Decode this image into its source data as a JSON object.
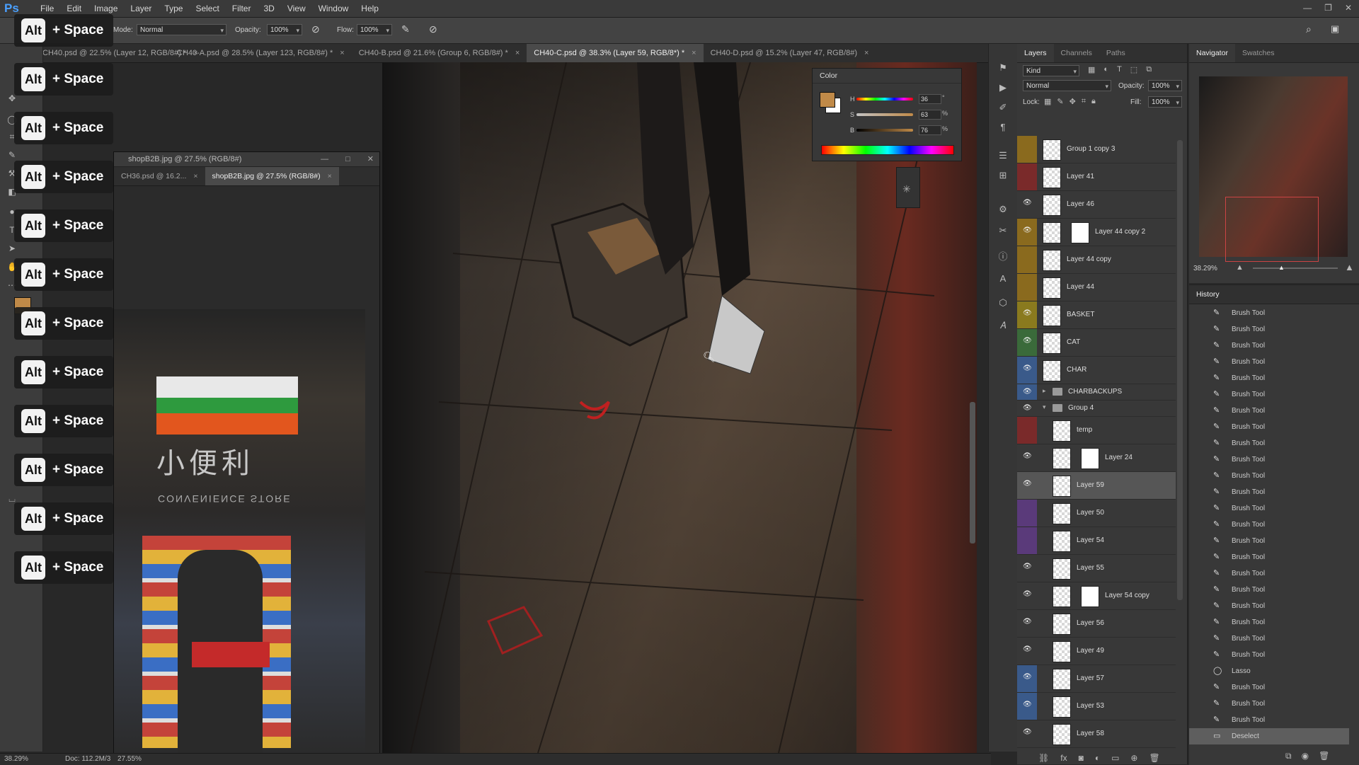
{
  "app": {
    "logo": "Ps"
  },
  "menu": [
    "File",
    "Edit",
    "Image",
    "Layer",
    "Type",
    "Select",
    "Filter",
    "3D",
    "View",
    "Window",
    "Help"
  ],
  "options": {
    "mode_label": "Mode:",
    "mode_value": "Normal",
    "opacity_label": "Opacity:",
    "opacity_value": "100%",
    "flow_label": "Flow:",
    "flow_value": "100%"
  },
  "tabs": [
    "CH40.psd @ 22.5% (Layer 12, RGB/8#) *",
    "CH40-A.psd @ 28.5% (Layer 123, RGB/8#) *",
    "CH40-B.psd @ 21.6% (Group 6, RGB/8#) *",
    "CH40-C.psd @ 38.3% (Layer 59, RGB/8*) *",
    "CH40-D.psd @ 15.2% (Layer 47, RGB/8#)"
  ],
  "shortcut": {
    "key": "Alt",
    "rest": "+ Space",
    "count": 12
  },
  "docwin": {
    "title": "shopB2B.jpg @ 27.5% (RGB/8#)",
    "tabs": [
      "CH36.psd @ 16.2...",
      "shopB2B.jpg @ 27.5% (RGB/8#)"
    ],
    "sign_cn": "小便利",
    "sign_en": "CONVENIENCE STORE"
  },
  "color": {
    "title": "Color",
    "h_label": "H",
    "h_value": "36",
    "s_label": "S",
    "s_value": "63",
    "b_label": "B",
    "b_value": "76",
    "swatch": "#c08a48"
  },
  "layers": {
    "tabs": [
      "Layers",
      "Channels",
      "Paths"
    ],
    "kind": "Kind",
    "blend": "Normal",
    "opacity_label": "Opacity:",
    "opacity_value": "100%",
    "lock_label": "Lock:",
    "fill_label": "Fill:",
    "fill_value": "100%",
    "rows": [
      {
        "name": "Group 1 copy 3",
        "tag": "#8a6a1e",
        "eye": false
      },
      {
        "name": "Layer 41",
        "tag": "#7a2a2a",
        "eye": false
      },
      {
        "name": "Layer 46",
        "tag": "",
        "eye": true
      },
      {
        "name": "Layer 44 copy 2",
        "tag": "#8a6a1e",
        "eye": true,
        "mask": true
      },
      {
        "name": "Layer 44 copy",
        "tag": "#8a6a1e",
        "eye": false
      },
      {
        "name": "Layer 44",
        "tag": "#8a6a1e",
        "eye": false
      },
      {
        "name": "BASKET",
        "tag": "#8a7a1e",
        "eye": true
      },
      {
        "name": "CAT",
        "tag": "#3a6a3a",
        "eye": true
      },
      {
        "name": "CHAR",
        "tag": "#3a5a8a",
        "eye": true
      }
    ],
    "groups": [
      {
        "name": "CHARBACKUPS",
        "tag": "#3a5a8a"
      },
      {
        "name": "Group 4",
        "tag": ""
      }
    ],
    "rows2": [
      {
        "name": "temp",
        "tag": "#7a2a2a",
        "eye": false
      },
      {
        "name": "Layer 24",
        "tag": "",
        "eye": true,
        "mask": true
      },
      {
        "name": "Layer 59",
        "tag": "",
        "eye": true,
        "selected": true
      },
      {
        "name": "Layer 50",
        "tag": "#5a3a7a",
        "eye": false
      },
      {
        "name": "Layer 54",
        "tag": "#5a3a7a",
        "eye": false
      },
      {
        "name": "Layer 55",
        "tag": "",
        "eye": true
      },
      {
        "name": "Layer 54 copy",
        "tag": "",
        "eye": true,
        "mask": true
      },
      {
        "name": "Layer 56",
        "tag": "",
        "eye": true
      },
      {
        "name": "Layer 49",
        "tag": "",
        "eye": true
      },
      {
        "name": "Layer 57",
        "tag": "#3a5a8a",
        "eye": true
      },
      {
        "name": "Layer 53",
        "tag": "#3a5a8a",
        "eye": true
      },
      {
        "name": "Layer 58",
        "tag": "",
        "eye": true
      }
    ]
  },
  "navigator": {
    "tabs": [
      "Navigator",
      "Swatches"
    ],
    "zoom": "38.29%"
  },
  "history": {
    "title": "History",
    "items": [
      "Brush Tool",
      "Brush Tool",
      "Brush Tool",
      "Brush Tool",
      "Brush Tool",
      "Brush Tool",
      "Brush Tool",
      "Brush Tool",
      "Brush Tool",
      "Brush Tool",
      "Brush Tool",
      "Brush Tool",
      "Brush Tool",
      "Brush Tool",
      "Brush Tool",
      "Brush Tool",
      "Brush Tool",
      "Brush Tool",
      "Brush Tool",
      "Brush Tool",
      "Brush Tool",
      "Brush Tool",
      "Lasso",
      "Brush Tool",
      "Brush Tool",
      "Brush Tool",
      "Deselect"
    ]
  },
  "status": {
    "zoom": "38.29%",
    "doc": "Doc: 112.2M/3",
    "docwin_zoom": "27.55%"
  }
}
